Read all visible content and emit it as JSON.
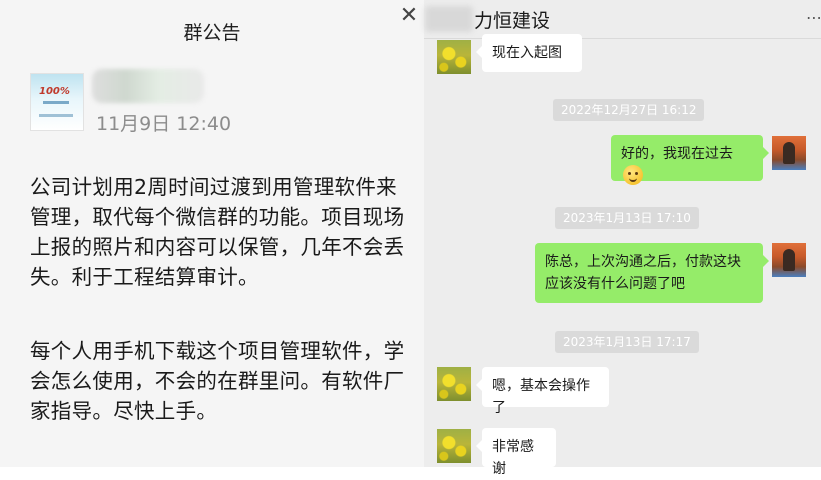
{
  "announcement": {
    "title": "群公告",
    "date": "11月9日 12:40",
    "paragraph1": "公司计划用2周时间过渡到用管理软件来管理，取代每个微信群的功能。项目现场上报的照片和内容可以保管，几年不会丢失。利于工程结算审计。",
    "paragraph2": "每个人用手机下载这个项目管理软件，学会怎么使用，不会的在群里问。有软件厂家指导。尽快上手。",
    "avatar_text": "100%"
  },
  "chat": {
    "title": "力恒建设",
    "close_icon": "close-icon",
    "more_icon": "more-icon",
    "messages": [
      {
        "type": "in",
        "text": "现在入起图"
      },
      {
        "type": "time",
        "text": "2022年12月27日 16:12"
      },
      {
        "type": "out",
        "text": "好的，我现在过去",
        "emoji": "smile-emoji-icon"
      },
      {
        "type": "time",
        "text": "2023年1月13日 17:10"
      },
      {
        "type": "out",
        "text": "陈总，上次沟通之后，付款这块应该没有什么问题了吧"
      },
      {
        "type": "time",
        "text": "2023年1月13日 17:17"
      },
      {
        "type": "in",
        "text": "嗯，基本会操作了"
      },
      {
        "type": "in",
        "text": "非常感谢"
      }
    ]
  },
  "colors": {
    "outgoing_bubble": "#95ec69",
    "incoming_bubble": "#ffffff",
    "chat_background": "#ededed",
    "announcement_background": "#f5f5f5"
  }
}
